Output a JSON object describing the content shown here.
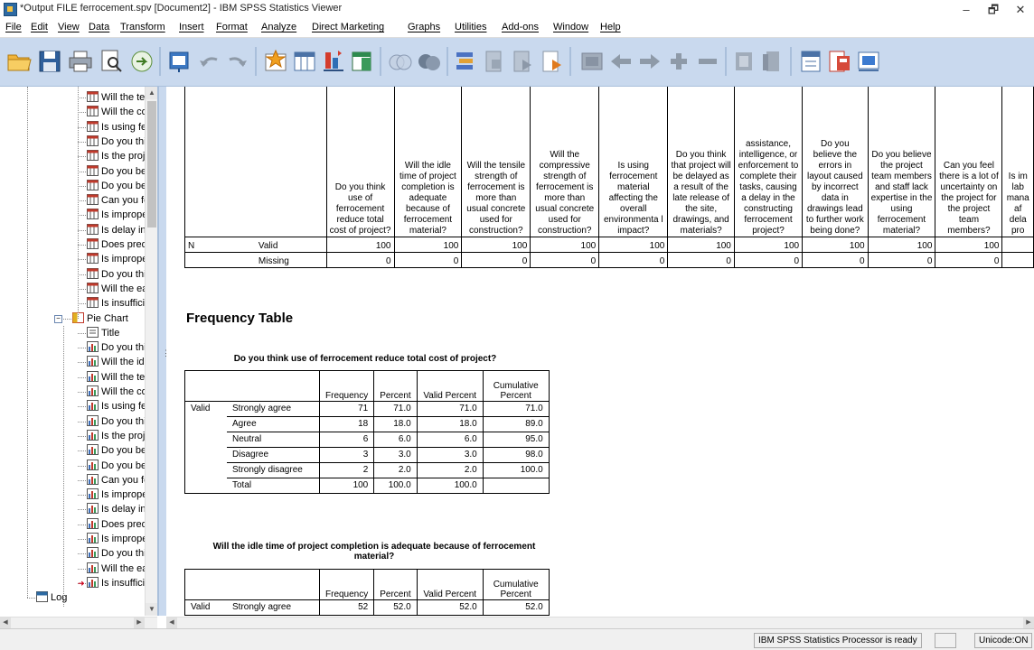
{
  "window": {
    "title": "*Output FILE ferrocement.spv [Document2] - IBM SPSS Statistics Viewer",
    "minimize": "–",
    "maximize": "🗗",
    "close": "✕"
  },
  "menu": [
    "File",
    "Edit",
    "View",
    "Data",
    "Transform",
    "Insert",
    "Format",
    "Analyze",
    "Direct Marketing",
    "Graphs",
    "Utilities",
    "Add-ons",
    "Window",
    "Help"
  ],
  "toolbar_icons": [
    "open-icon",
    "save-icon",
    "print-icon",
    "print-preview-icon",
    "export-icon",
    "recall-dialog-icon",
    "undo-icon",
    "redo-icon",
    "goto-case-icon",
    "goto-variable-icon",
    "variables-icon",
    "select-last-output-icon",
    "chart-icon",
    "designate-window-icon",
    "show-all-variables-icon",
    "split-file-icon",
    "select-cases-icon",
    "value-labels-icon",
    "use-variable-sets-icon",
    "previous-icon",
    "next-icon",
    "expand-icon",
    "collapse-icon",
    "show-icon",
    "hide-icon",
    "insert-heading-icon",
    "insert-title-icon",
    "insert-text-icon"
  ],
  "outline": {
    "stats_items": [
      "Will the ter",
      "Will the co",
      "Is using fe",
      "Do you thi",
      "Is the proj",
      "Do you be",
      "Do you be",
      "Can you fe",
      "Is imprope",
      "Is delay in",
      "Does pred",
      "Is imprope",
      "Do you thi",
      "Will the ea",
      "Is insuffici"
    ],
    "pie_chart_label": "Pie Chart",
    "title_label": "Title",
    "pie_items": [
      "Do you thi",
      "Will the idl",
      "Will the ter",
      "Will the co",
      "Is using fe",
      "Do you thi",
      "Is the proj",
      "Do you be",
      "Do you be",
      "Can you fe",
      "Is imprope",
      "Is delay in",
      "Does pred",
      "Is imprope",
      "Do you thi",
      "Will the ea",
      "Is insuffici"
    ],
    "log_label": "Log"
  },
  "stats_table": {
    "columns": [
      "Do you think use of ferrocement reduce total cost of project?",
      "Will the idle time of project completion is adequate because of ferrocement material?",
      "Will the tensile strength of ferrocement is more than usual concrete used for construction?",
      "Will the compressive strength of ferrocement is more than usual concrete used for construction?",
      "Is using ferrocement material affecting the overall environmenta l impact?",
      "Do you think that project will be delayed as a result of the late release of the site, drawings, and materials?",
      "assistance, intelligence, or enforcement to complete their tasks, causing a delay in the constructing ferrocement project?",
      "Do you believe the errors in layout caused by incorrect data in drawings lead to further work being done?",
      "Do you believe the project team members and staff lack expertise in the using ferrocement material?",
      "Can you feel there is a lot of uncertainty on the project for the project team members?",
      "Is im lab mana af dela pro"
    ],
    "n_label": "N",
    "valid_label": "Valid",
    "missing_label": "Missing",
    "valid": [
      "100",
      "100",
      "100",
      "100",
      "100",
      "100",
      "100",
      "100",
      "100",
      "100",
      ""
    ],
    "missing": [
      "0",
      "0",
      "0",
      "0",
      "0",
      "0",
      "0",
      "0",
      "0",
      "0",
      ""
    ]
  },
  "frequency_title": "Frequency Table",
  "freq1": {
    "caption": "Do you think use of ferrocement reduce total cost of project?",
    "headers": [
      "Frequency",
      "Percent",
      "Valid Percent",
      "Cumulative Percent"
    ],
    "valid_label": "Valid",
    "rows": [
      {
        "label": "Strongly agree",
        "f": "71",
        "p": "71.0",
        "vp": "71.0",
        "cp": "71.0"
      },
      {
        "label": "Agree",
        "f": "18",
        "p": "18.0",
        "vp": "18.0",
        "cp": "89.0"
      },
      {
        "label": "Neutral",
        "f": "6",
        "p": "6.0",
        "vp": "6.0",
        "cp": "95.0"
      },
      {
        "label": "Disagree",
        "f": "3",
        "p": "3.0",
        "vp": "3.0",
        "cp": "98.0"
      },
      {
        "label": "Strongly disagree",
        "f": "2",
        "p": "2.0",
        "vp": "2.0",
        "cp": "100.0"
      },
      {
        "label": "Total",
        "f": "100",
        "p": "100.0",
        "vp": "100.0",
        "cp": ""
      }
    ]
  },
  "freq2": {
    "caption": "Will the idle time of project completion is adequate because of ferrocement material?",
    "headers": [
      "Frequency",
      "Percent",
      "Valid Percent",
      "Cumulative Percent"
    ],
    "valid_label": "Valid",
    "rows": [
      {
        "label": "Strongly agree",
        "f": "52",
        "p": "52.0",
        "vp": "52.0",
        "cp": "52.0"
      }
    ]
  },
  "status": {
    "processor": "IBM SPSS Statistics Processor is ready",
    "unicode": "Unicode:ON"
  }
}
